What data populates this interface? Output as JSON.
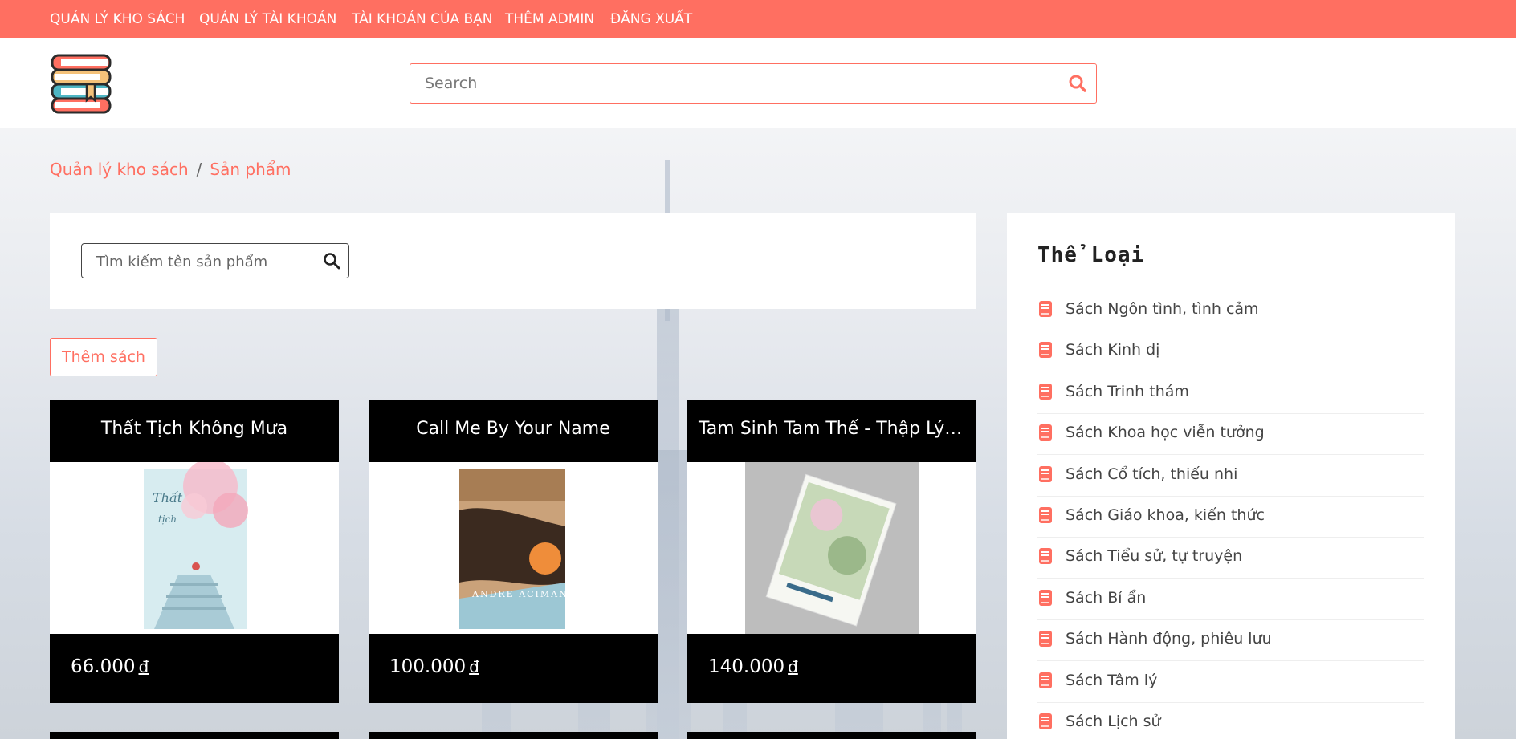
{
  "topnav": {
    "items": [
      {
        "label": "QUẢN LÝ KHO SÁCH"
      },
      {
        "label": "QUẢN LÝ TÀI KHOẢN"
      },
      {
        "label": "TÀI KHOẢN CỦA BẠN"
      },
      {
        "label": "THÊM ADMIN"
      },
      {
        "label": "ĐĂNG XUẤT"
      }
    ]
  },
  "header": {
    "search_placeholder": "Search"
  },
  "breadcrumb": {
    "items": [
      "Quản lý kho sách",
      "Sản phẩm"
    ],
    "separator": "/"
  },
  "product_search": {
    "placeholder": "Tìm kiếm tên sản phẩm"
  },
  "add_button": "Thêm sách",
  "products": [
    {
      "title": "Thất Tịch Không Mưa",
      "price": "66.000",
      "currency": "đ"
    },
    {
      "title": "Call Me By Your Name",
      "price": "100.000",
      "currency": "đ"
    },
    {
      "title": "Tam Sinh Tam Thế - Thập Lý Đào Hoa",
      "price": "140.000",
      "currency": "đ"
    }
  ],
  "sidebar": {
    "title": "Thể Loại",
    "categories": [
      "Sách Ngôn tình, tình cảm",
      "Sách Kinh dị",
      "Sách Trinh thám",
      "Sách Khoa học viễn tưởng",
      "Sách Cổ tích, thiếu nhi",
      "Sách Giáo khoa, kiến thức",
      "Sách Tiểu sử, tự truyện",
      "Sách Bí ẩn",
      "Sách Hành động, phiêu lưu",
      "Sách Tâm lý",
      "Sách Lịch sử"
    ]
  },
  "colors": {
    "accent": "#ff6f61",
    "card_dark": "#000000"
  }
}
